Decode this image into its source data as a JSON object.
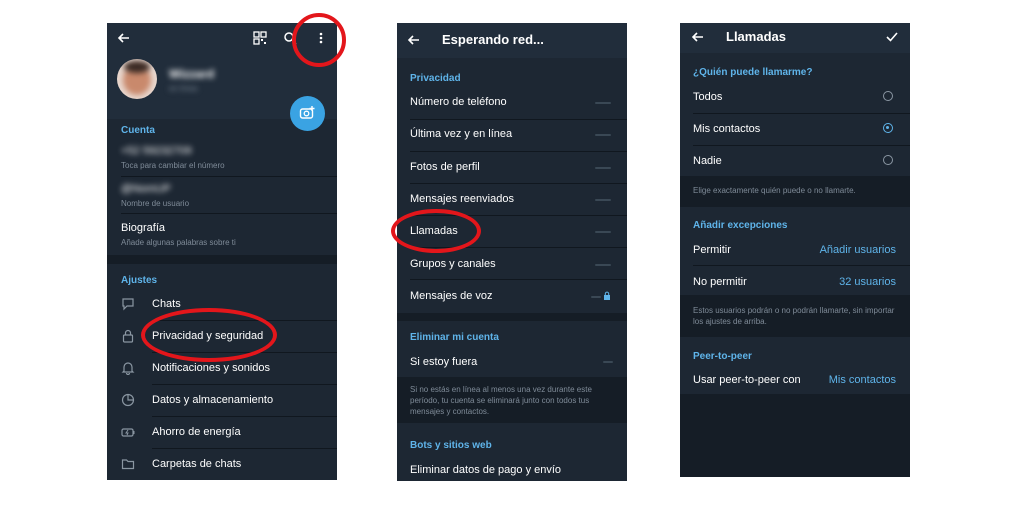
{
  "colors": {
    "accent": "#5fb4ea",
    "background": "#1d2733",
    "header": "#212d3b",
    "highlight": "#e3161b"
  },
  "panel1": {
    "icons": [
      "back-arrow-icon",
      "qr-code-icon",
      "search-icon",
      "more-vert-icon",
      "camera-add-icon"
    ],
    "profile_name": "Wizzard",
    "profile_status": "en línea",
    "account_section": "Cuenta",
    "phone_value": "+52 59232709",
    "phone_hint": "Toca para cambiar el número",
    "username_value": "@NomUP",
    "username_hint": "Nombre de usuario",
    "bio_title": "Biografía",
    "bio_hint": "Añade algunas palabras sobre ti",
    "settings_section": "Ajustes",
    "items": [
      {
        "label": "Chats",
        "icon": "chat-bubble-icon"
      },
      {
        "label": "Privacidad y seguridad",
        "icon": "lock-icon"
      },
      {
        "label": "Notificaciones y sonidos",
        "icon": "bell-icon"
      },
      {
        "label": "Datos y almacenamiento",
        "icon": "pie-chart-icon"
      },
      {
        "label": "Ahorro de energía",
        "icon": "battery-icon"
      },
      {
        "label": "Carpetas de chats",
        "icon": "folder-icon"
      }
    ]
  },
  "panel2": {
    "title": "Esperando red...",
    "privacy_section": "Privacidad",
    "items": [
      {
        "label": "Número de teléfono"
      },
      {
        "label": "Última vez y en línea"
      },
      {
        "label": "Fotos de perfil"
      },
      {
        "label": "Mensajes reenviados"
      },
      {
        "label": "Llamadas"
      },
      {
        "label": "Grupos y canales"
      },
      {
        "label": "Mensajes de voz"
      }
    ],
    "delete_section": "Eliminar mi cuenta",
    "away_label": "Si estoy fuera",
    "away_info": "Si no estás en línea al menos una vez durante este período, tu cuenta se eliminará junto con todos tus mensajes y contactos.",
    "bots_section": "Bots y sitios web",
    "payment_label": "Eliminar datos de pago y envío"
  },
  "panel3": {
    "title": "Llamadas",
    "who_section": "¿Quién puede llamarme?",
    "options": [
      {
        "label": "Todos",
        "selected": false
      },
      {
        "label": "Mis contactos",
        "selected": true
      },
      {
        "label": "Nadie",
        "selected": false
      }
    ],
    "who_info": "Elige exactamente quién puede o no llamarte.",
    "exceptions_section": "Añadir excepciones",
    "allow_label": "Permitir",
    "allow_value": "Añadir usuarios",
    "deny_label": "No permitir",
    "deny_value": "32 usuarios",
    "exceptions_info": "Estos usuarios podrán o no podrán llamarte, sin importar los ajustes de arriba.",
    "p2p_section": "Peer-to-peer",
    "p2p_label": "Usar peer-to-peer con",
    "p2p_value": "Mis contactos"
  }
}
